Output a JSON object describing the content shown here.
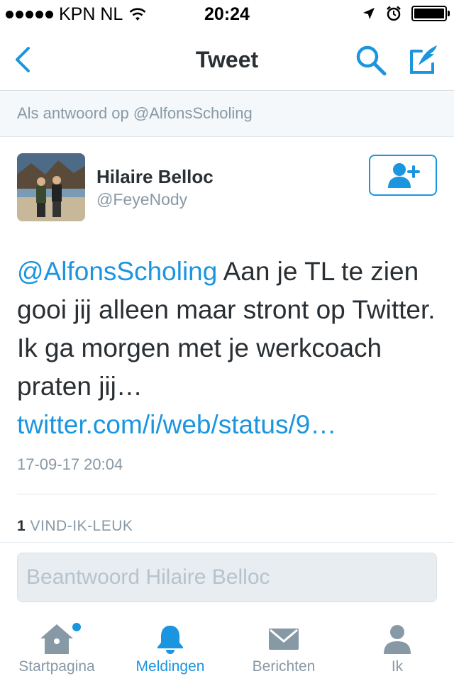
{
  "status_bar": {
    "carrier": "KPN NL",
    "time": "20:24",
    "signal_bars": 5
  },
  "nav": {
    "title": "Tweet",
    "back_icon": "chevron-left-icon",
    "search_icon": "search-icon",
    "compose_icon": "compose-tweet-icon"
  },
  "reply_context": "Als antwoord op @AlfonsScholing",
  "tweet": {
    "author_name": "Hilaire Belloc",
    "author_handle": "@FeyeNody",
    "mention": "@AlfonsScholing",
    "text": " Aan je TL te zien gooi jij alleen maar stront op Twitter. Ik ga morgen met je werkcoach praten jij…",
    "link": "twitter.com/i/web/status/9…",
    "timestamp": "17-09-17 20:04",
    "likes_count": "1",
    "likes_label": " VIND-IK-LEUK"
  },
  "composer": {
    "placeholder": "Beantwoord Hilaire Belloc"
  },
  "tabs": [
    {
      "label": "Startpagina",
      "icon": "home-icon",
      "active": false,
      "has_dot": true
    },
    {
      "label": "Meldingen",
      "icon": "bell-icon",
      "active": true
    },
    {
      "label": "Berichten",
      "icon": "envelope-icon",
      "active": false
    },
    {
      "label": "Ik",
      "icon": "person-icon",
      "active": false
    }
  ],
  "colors": {
    "accent": "#1b95e0",
    "text": "#292f33",
    "muted": "#8899a6",
    "inactive_icon": "#8899a6"
  }
}
